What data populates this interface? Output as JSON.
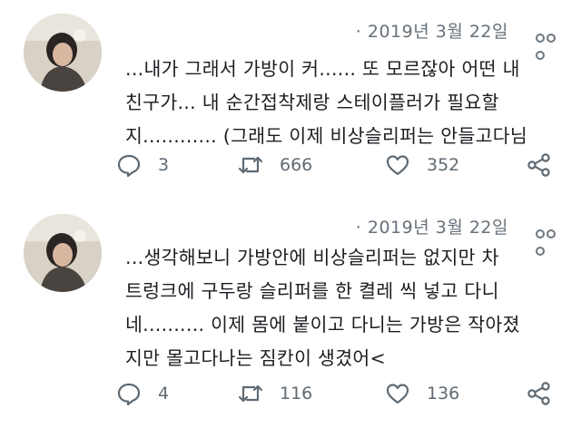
{
  "tweets": [
    {
      "timestamp": "· 2019년 3월 22일",
      "lines": [
        "...내가 그래서 가방이 커...... 또 모르잖아 어떤  내",
        "친구가... 내 순간접착제랑 스테이플러가 필요할",
        "지............ (그래도 이제 비상슬리퍼는 안들고다님"
      ],
      "replies": "3",
      "retweets": "666",
      "likes": "352"
    },
    {
      "timestamp": "· 2019년 3월 22일",
      "lines": [
        "...생각해보니 가방안에 비상슬리퍼는 없지만 차",
        "트렁크에 구두랑 슬리퍼를 한 켤레 씩 넣고 다니",
        "네.......... 이제 몸에 붙이고 다니는 가방은 작아졌",
        "지만 몰고다나는 짐칸이 생겼어<"
      ],
      "replies": "4",
      "retweets": "116",
      "likes": "136"
    }
  ],
  "icons": {
    "reply": "reply-icon",
    "retweet": "retweet-icon",
    "like": "heart-icon",
    "share": "share-icon",
    "more": "more-options-icon"
  },
  "colors": {
    "text": "#1b1e22",
    "muted": "#66707a",
    "icon": "#5f6a73"
  }
}
